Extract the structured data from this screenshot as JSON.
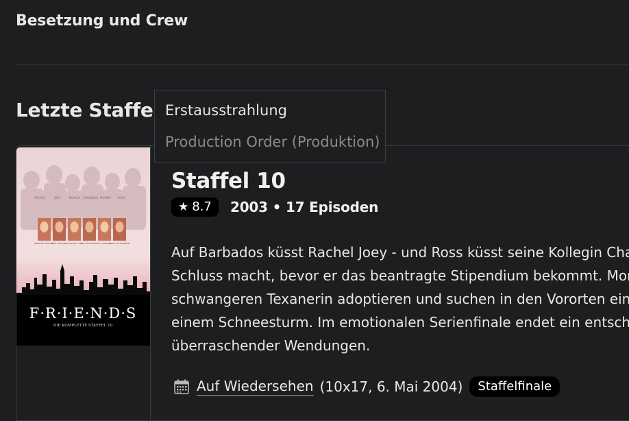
{
  "cast_crew": {
    "label": "Besetzung und Crew"
  },
  "last_season": {
    "heading": "Letzte Staffel"
  },
  "sort_dropdown": {
    "options": [
      "Erstausstrahlung",
      "Production Order (Produktion)"
    ]
  },
  "season": {
    "title": "Staffel 10",
    "rating": "8.7",
    "meta": "2003 • 17 Episoden",
    "overview_lines": [
      "Auf Barbados küsst Rachel Joey - und Ross küsst seine Kollegin Cha",
      "Schluss macht, bevor er das beantragte Stipendium bekommt. Mon",
      "schwangeren Texanerin adoptieren und suchen in den Vororten ein",
      "einem Schneesturm. Im emotionalen Serienfinale endet ein entsch",
      "überraschender Wendungen."
    ],
    "last_episode": {
      "title": "Auf Wiedersehen",
      "details": "(10x17, 6. Mai 2004)",
      "badge": "Staffelfinale"
    }
  },
  "poster": {
    "logo_text": "F·R·I·E·N·D·S",
    "subtitle": "DIE KOMPLETTE STAFFEL 10",
    "cast_names": [
      "JENNIFER ANISTON",
      "MATT LEBLANC",
      "COURTENEY COX",
      "MATTHEW PERRY",
      "LISA KUDROW",
      "DAVID SCHWIMMER"
    ],
    "top_names": [
      "RACHEL",
      "JOEY",
      "MONICA",
      "CHANDLER",
      "PHOEBE",
      "ROSS"
    ]
  },
  "icons": {
    "star": "star-icon",
    "calendar": "calendar-icon"
  }
}
